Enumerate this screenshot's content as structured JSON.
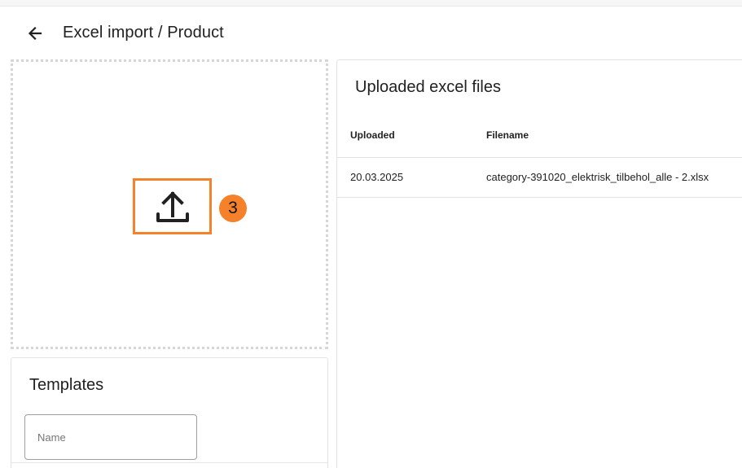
{
  "header": {
    "back_icon": "arrow-left-icon",
    "title": "Excel import / Product"
  },
  "dropzone": {
    "icon": "upload-icon",
    "step_badge": "3",
    "highlight_color": "#f5822a"
  },
  "templates": {
    "title": "Templates",
    "name_placeholder": "Name"
  },
  "uploaded_files": {
    "title": "Uploaded excel files",
    "columns": [
      "Uploaded",
      "Filename"
    ],
    "rows": [
      {
        "uploaded": "20.03.2025",
        "filename": "category-391020_elektrisk_tilbehol_alle - 2.xlsx"
      }
    ]
  }
}
